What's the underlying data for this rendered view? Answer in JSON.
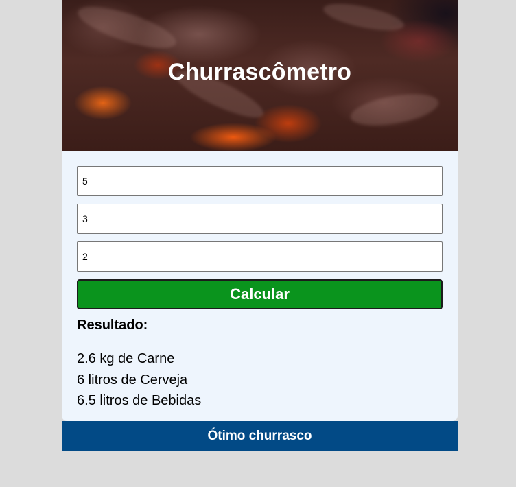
{
  "header": {
    "title": "Churrascômetro"
  },
  "form": {
    "adults_value": "5",
    "children_value": "3",
    "duration_value": "2",
    "calculate_label": "Calcular"
  },
  "result": {
    "heading": "Resultado:",
    "meat": "2.6 kg de Carne",
    "beer": "6 litros de Cerveja",
    "drinks": "6.5 litros de Bebidas"
  },
  "footer": {
    "text": "Ótimo churrasco"
  }
}
